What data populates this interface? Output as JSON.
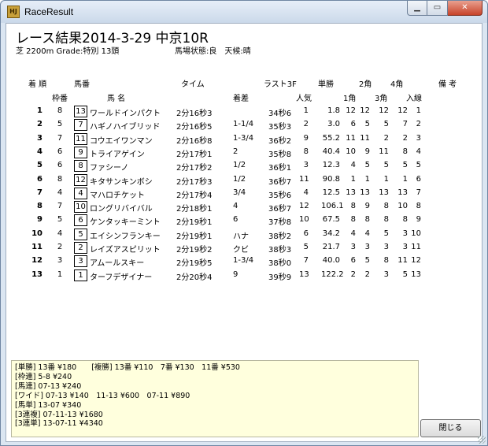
{
  "window": {
    "title": "RaceResult",
    "icon_text": "HJ",
    "close_glyph": "✕",
    "min_glyph": "▁",
    "max_glyph": "▭"
  },
  "race": {
    "title": "レース結果2014-3-29 中京10R",
    "info": "芝 2200m Grade:特別 13頭",
    "conditions": "馬場状態:良　天候:晴"
  },
  "headers": {
    "rank": "着 順",
    "umaban": "馬番",
    "time": "タイム",
    "last3f": "ラスト3F",
    "odds": "単勝",
    "c2": "2角",
    "c4": "4角",
    "remarks": "備 考",
    "waku": "枠番",
    "name": "馬 名",
    "margin": "着差",
    "popularity": "人気",
    "c1": "1角",
    "c3": "3角",
    "entry": "入線"
  },
  "results": [
    {
      "rank": "1",
      "waku": "8",
      "uma": "13",
      "name": "ワールドインパクト",
      "time": "2分16秒3",
      "margin": "",
      "l3f": "34秒6",
      "pop": "1",
      "odds": "1.8",
      "p1": "12",
      "p2": "12",
      "p3": "12",
      "p4": "12",
      "p5": "1"
    },
    {
      "rank": "2",
      "waku": "5",
      "uma": "7",
      "name": "ハギノハイブリッド",
      "time": "2分16秒5",
      "margin": "1-1/4",
      "l3f": "35秒3",
      "pop": "2",
      "odds": "3.0",
      "p1": "6",
      "p2": "5",
      "p3": "5",
      "p4": "7",
      "p5": "2"
    },
    {
      "rank": "3",
      "waku": "7",
      "uma": "11",
      "name": "コウエイワンマン",
      "time": "2分16秒8",
      "margin": "1-3/4",
      "l3f": "36秒2",
      "pop": "9",
      "odds": "55.2",
      "p1": "11",
      "p2": "11",
      "p3": "2",
      "p4": "2",
      "p5": "3"
    },
    {
      "rank": "4",
      "waku": "6",
      "uma": "9",
      "name": "トライアゲイン",
      "time": "2分17秒1",
      "margin": "2",
      "l3f": "35秒8",
      "pop": "8",
      "odds": "40.4",
      "p1": "10",
      "p2": "9",
      "p3": "11",
      "p4": "8",
      "p5": "4"
    },
    {
      "rank": "5",
      "waku": "6",
      "uma": "8",
      "name": "ファシーノ",
      "time": "2分17秒2",
      "margin": "1/2",
      "l3f": "36秒1",
      "pop": "3",
      "odds": "12.3",
      "p1": "4",
      "p2": "5",
      "p3": "5",
      "p4": "5",
      "p5": "5"
    },
    {
      "rank": "6",
      "waku": "8",
      "uma": "12",
      "name": "キタサンキンボシ",
      "time": "2分17秒3",
      "margin": "1/2",
      "l3f": "36秒7",
      "pop": "11",
      "odds": "90.8",
      "p1": "1",
      "p2": "1",
      "p3": "1",
      "p4": "1",
      "p5": "6"
    },
    {
      "rank": "7",
      "waku": "4",
      "uma": "4",
      "name": "マハロチケット",
      "time": "2分17秒4",
      "margin": "3/4",
      "l3f": "35秒6",
      "pop": "4",
      "odds": "12.5",
      "p1": "13",
      "p2": "13",
      "p3": "13",
      "p4": "13",
      "p5": "7"
    },
    {
      "rank": "8",
      "waku": "7",
      "uma": "10",
      "name": "ロングリバイバル",
      "time": "2分18秒1",
      "margin": "4",
      "l3f": "36秒7",
      "pop": "12",
      "odds": "106.1",
      "p1": "8",
      "p2": "9",
      "p3": "8",
      "p4": "10",
      "p5": "8"
    },
    {
      "rank": "9",
      "waku": "5",
      "uma": "6",
      "name": "ケンタッキーミント",
      "time": "2分19秒1",
      "margin": "6",
      "l3f": "37秒8",
      "pop": "10",
      "odds": "67.5",
      "p1": "8",
      "p2": "8",
      "p3": "8",
      "p4": "8",
      "p5": "9"
    },
    {
      "rank": "10",
      "waku": "4",
      "uma": "5",
      "name": "エイシンフランキー",
      "time": "2分19秒1",
      "margin": "ハナ",
      "l3f": "38秒2",
      "pop": "6",
      "odds": "34.2",
      "p1": "4",
      "p2": "4",
      "p3": "5",
      "p4": "3",
      "p5": "10"
    },
    {
      "rank": "11",
      "waku": "2",
      "uma": "2",
      "name": "レイズアスピリット",
      "time": "2分19秒2",
      "margin": "クビ",
      "l3f": "38秒3",
      "pop": "5",
      "odds": "21.7",
      "p1": "3",
      "p2": "3",
      "p3": "3",
      "p4": "3",
      "p5": "11"
    },
    {
      "rank": "12",
      "waku": "3",
      "uma": "3",
      "name": "アムールスキー",
      "time": "2分19秒5",
      "margin": "1-3/4",
      "l3f": "38秒0",
      "pop": "7",
      "odds": "40.0",
      "p1": "6",
      "p2": "5",
      "p3": "8",
      "p4": "11",
      "p5": "12"
    },
    {
      "rank": "13",
      "waku": "1",
      "uma": "1",
      "name": "ターフデザイナー",
      "time": "2分20秒4",
      "margin": "9",
      "l3f": "39秒9",
      "pop": "13",
      "odds": "122.2",
      "p1": "2",
      "p2": "2",
      "p3": "3",
      "p4": "5",
      "p5": "13"
    }
  ],
  "payouts": [
    "[単勝] 13番 ¥180　　[複勝] 13番 ¥110　7番 ¥130　11番 ¥530",
    "[枠連] 5-8 ¥240",
    "[馬連] 07-13 ¥240",
    "[ワイド] 07-13 ¥140　11-13 ¥600　07-11 ¥890",
    "[馬単] 13-07 ¥340",
    "[3連複] 07-11-13 ¥1680",
    "[3連単] 13-07-11 ¥4340"
  ],
  "buttons": {
    "close_label": "閉じる"
  }
}
